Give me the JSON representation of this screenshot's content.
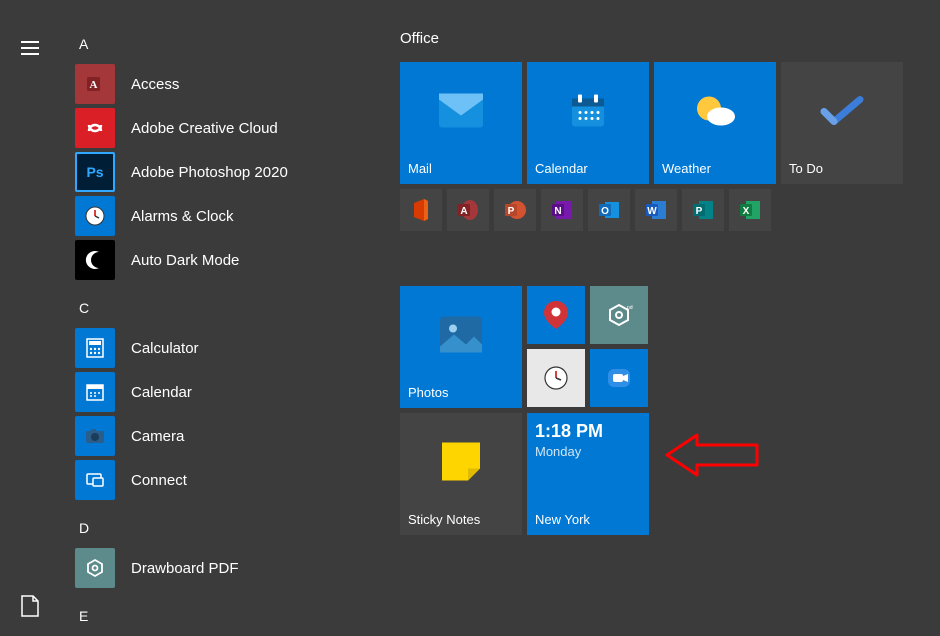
{
  "rail": {
    "menu": "menu",
    "documents": "documents"
  },
  "apps": {
    "groupA": "A",
    "groupC": "C",
    "groupD": "D",
    "groupE": "E",
    "a1": "Access",
    "a2": "Adobe Creative Cloud",
    "a3": "Adobe Photoshop 2020",
    "a4": "Alarms & Clock",
    "a5": "Auto Dark Mode",
    "c1": "Calculator",
    "c2": "Calendar",
    "c3": "Camera",
    "c4": "Connect",
    "d1": "Drawboard PDF"
  },
  "tiles": {
    "group_office": "Office",
    "mail": "Mail",
    "calendar": "Calendar",
    "weather": "Weather",
    "todo": "To Do",
    "photos": "Photos",
    "sticky": "Sticky Notes",
    "clock_time": "1:18 PM",
    "clock_day": "Monday",
    "clock_city": "New York"
  }
}
